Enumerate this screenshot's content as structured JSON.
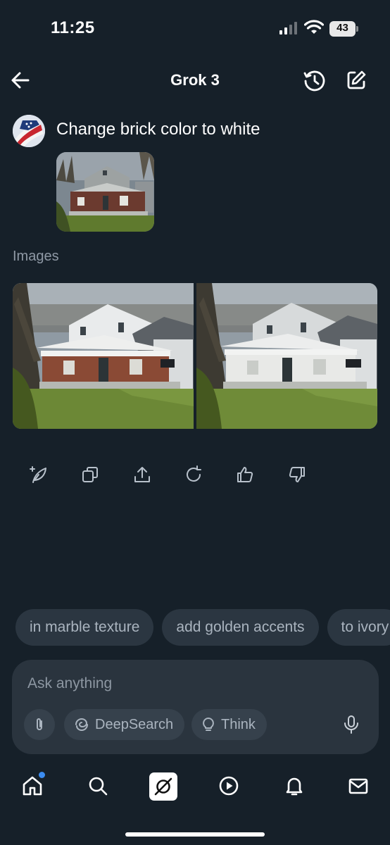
{
  "status_bar": {
    "time": "11:25",
    "battery": "43"
  },
  "header": {
    "title": "Grok 3"
  },
  "icons": {
    "back": "arrow-left-icon",
    "history": "history-icon",
    "compose": "compose-icon"
  },
  "conversation": {
    "user_message": "Change brick color to white",
    "images_label": "Images"
  },
  "actions": [
    "edit-image",
    "copy",
    "share",
    "regenerate",
    "like",
    "dislike"
  ],
  "suggestions": [
    "in marble texture",
    "add golden accents",
    "to ivory"
  ],
  "composer": {
    "placeholder": "Ask anything",
    "deepsearch_label": "DeepSearch",
    "think_label": "Think"
  },
  "nav": [
    "home",
    "search",
    "grok",
    "video",
    "notifications",
    "messages"
  ],
  "colors": {
    "background": "#162029",
    "surface": "#2a343e",
    "chip": "#2b3641",
    "accent_dot": "#3b8cf0"
  }
}
